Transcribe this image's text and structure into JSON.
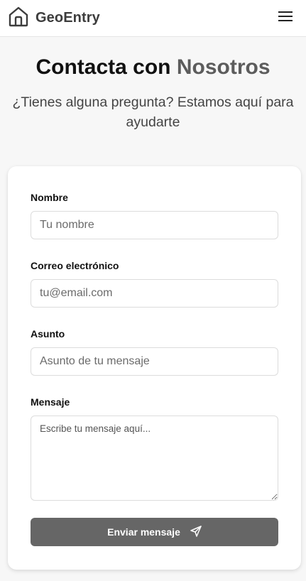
{
  "header": {
    "brand": "GeoEntry",
    "logo_icon": "house-icon",
    "menu_icon": "hamburger-menu-icon"
  },
  "hero": {
    "title_main": "Contacta con",
    "title_accent": "Nosotros",
    "subtitle": "¿Tienes alguna pregunta? Estamos aquí para ayudarte"
  },
  "form": {
    "name": {
      "label": "Nombre",
      "placeholder": "Tu nombre"
    },
    "email": {
      "label": "Correo electrónico",
      "placeholder": "tu@email.com"
    },
    "subject": {
      "label": "Asunto",
      "placeholder": "Asunto de tu mensaje"
    },
    "message": {
      "label": "Mensaje",
      "placeholder": "Escribe tu mensaje aquí..."
    },
    "submit": {
      "label": "Enviar mensaje",
      "icon": "send-icon"
    }
  },
  "colors": {
    "accent": "#5c5c5c",
    "button": "#666666",
    "background": "#f7f7f7"
  }
}
